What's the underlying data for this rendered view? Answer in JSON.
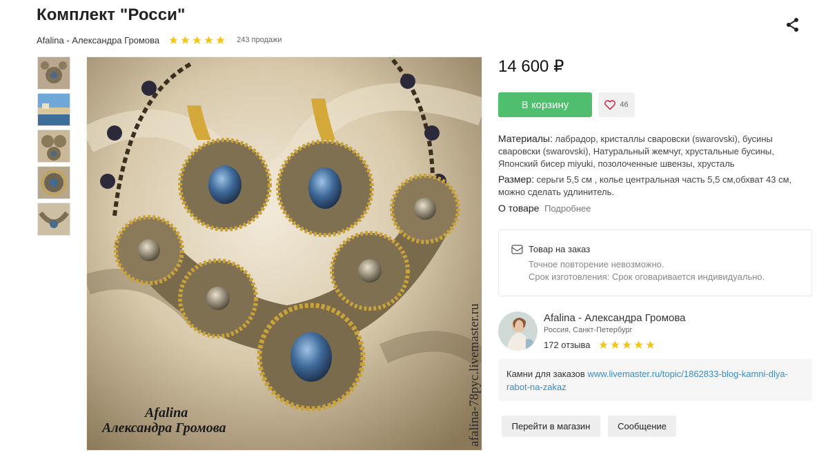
{
  "product": {
    "title": "Комплект \"Росси\"",
    "seller": "Afalina - Александра Громова",
    "rating": 5,
    "sales": "243 продажи",
    "price": "14 600 ₽"
  },
  "actions": {
    "cart_label": "В корзину",
    "fav_count": "46",
    "shop_label": "Перейти в магазин",
    "message_label": "Сообщение"
  },
  "details": {
    "materials_label": "Материалы:",
    "materials_value": "лабрадор, кристаллы сваровски (swarovski), бусины сваровски (swarovski), Натуральный жемчуг, хрустальные бусины, Японский бисер miyuki, позолоченные швензы, хрусталь",
    "size_label": "Размер:",
    "size_value": "серьги 5,5 см , колье центральная часть 5,5 см,обхват 43 см, можно сделать удлинитель.",
    "about_label": "О товаре",
    "about_more": "Подробнее"
  },
  "order": {
    "title": "Товар на заказ",
    "line1": "Точное повторение невозможно.",
    "line2": "Срок изготовления: Срок оговаривается индивидуально."
  },
  "seller_card": {
    "name": "Afalina - Александра Громова",
    "location": "Россия, Санкт-Петербург",
    "reviews": "172 отзыва",
    "rating": 5
  },
  "note": {
    "text": "Камни для заказов ",
    "link": "www.livemaster.ru/topic/1862833-blog-kamni-dlya-rabot-na-zakaz"
  },
  "image_watermark": {
    "line1": "Afalina",
    "line2": "Александра Громова",
    "vertical": "afalina-78рус.livemaster.ru"
  },
  "colors": {
    "accent_green": "#4fbf6e",
    "star_yellow": "#f5c518",
    "link_blue": "#3a8ac9"
  },
  "icons": [
    "share-icon",
    "star-icon",
    "heart-icon",
    "order-icon"
  ]
}
